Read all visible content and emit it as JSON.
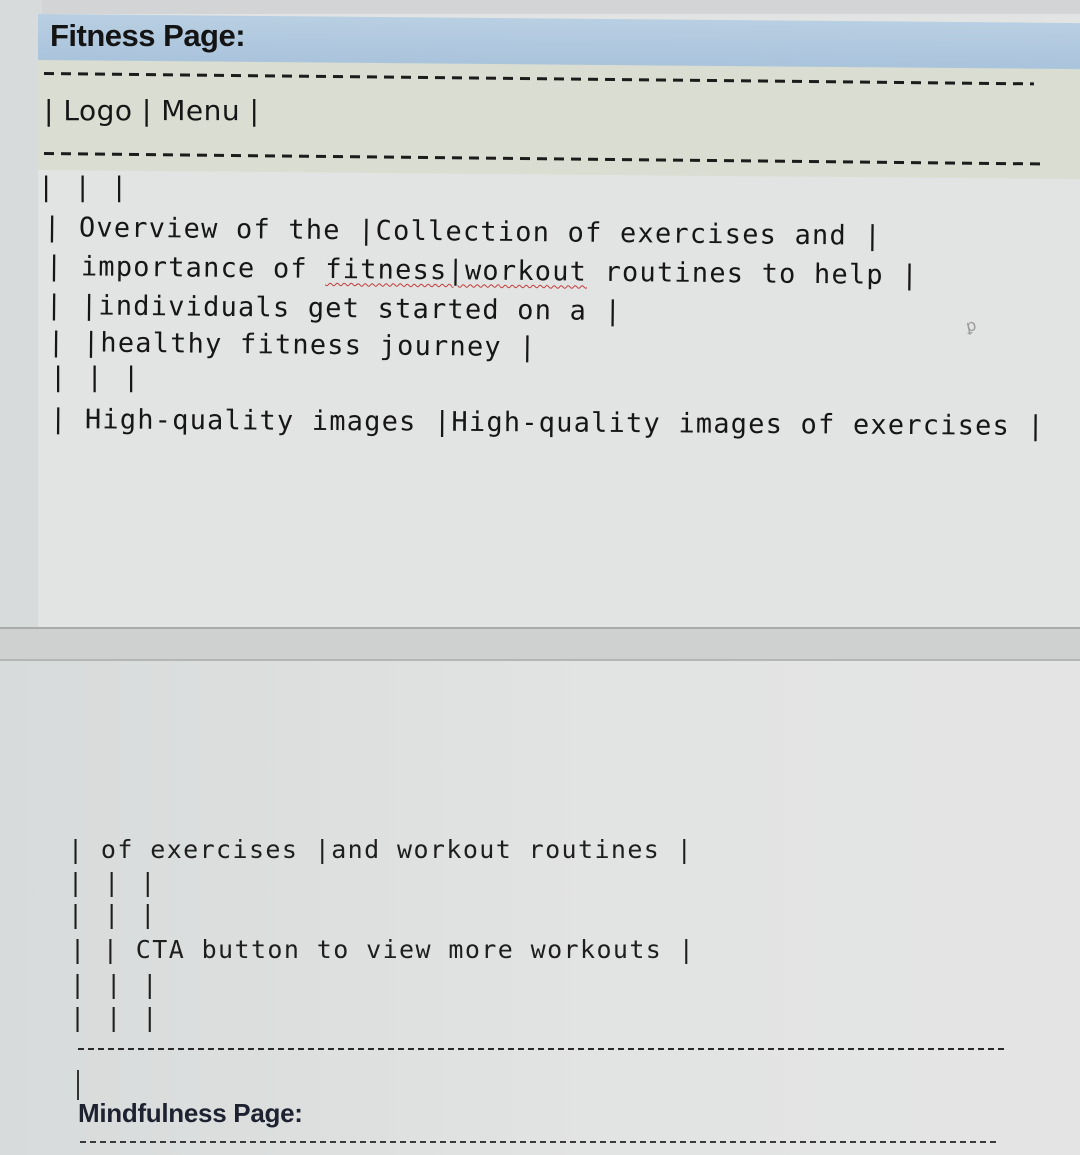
{
  "fitness_page": {
    "heading": "Fitness Page:",
    "nav_row": "| Logo | Menu |",
    "nav_items": [
      "Logo",
      "Menu"
    ],
    "wireframe_lines": [
      "| | |",
      "| Overview of the |Collection of exercises and |",
      "| importance of fitness|workout routines to help |",
      "| |individuals get started on a |",
      "| |healthy fitness journey |",
      "| | |",
      "| High-quality images |High-quality images of exercises |"
    ],
    "spellcheck_flagged": "fitness|workout",
    "continued_lines": [
      "| of exercises |and workout routines |",
      "| | |",
      "| | |",
      "| | CTA button to view more workouts |",
      "| | |",
      "| | |"
    ]
  },
  "mindfulness_page": {
    "heading": "Mindfulness Page:"
  },
  "colors": {
    "heading_band": "#aec7de",
    "highlight": "#d9ddd2",
    "spellcheck_underline": "#c23a3a"
  }
}
